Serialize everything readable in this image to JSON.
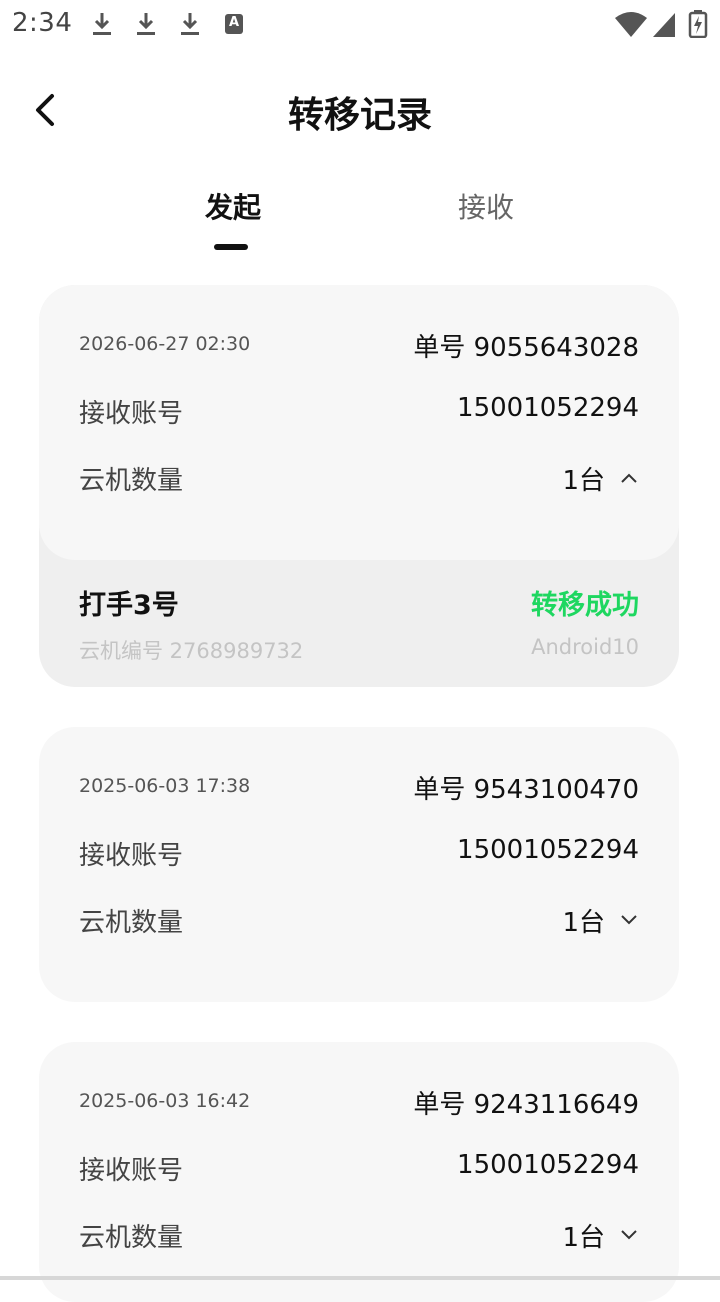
{
  "status_bar": {
    "time": "2:34",
    "icons": [
      "download-icon",
      "download-icon",
      "download-icon",
      "a-badge-icon",
      "wifi-icon",
      "signal-icon",
      "battery-charging-icon"
    ],
    "badge_letter": "A"
  },
  "header": {
    "title": "转移记录",
    "back_icon": "chevron-left-icon"
  },
  "tabs": [
    {
      "label": "发起",
      "active": true
    },
    {
      "label": "接收",
      "active": false
    }
  ],
  "records": [
    {
      "date": "2026-06-27 02:30",
      "order": "单号 9055643028",
      "receiver_label": "接收账号",
      "receiver": "15001052294",
      "count_label": "云机数量",
      "count": "1台",
      "expanded": true,
      "device": {
        "name": "打手3号",
        "status": "转移成功",
        "id": "云机编号 2768989732",
        "os": "Android10"
      }
    },
    {
      "date": "2025-06-03 17:38",
      "order": "单号 9543100470",
      "receiver_label": "接收账号",
      "receiver": "15001052294",
      "count_label": "云机数量",
      "count": "1台",
      "expanded": false
    },
    {
      "date": "2025-06-03 16:42",
      "order": "单号 9243116649",
      "receiver_label": "接收账号",
      "receiver": "15001052294",
      "count_label": "云机数量",
      "count": "1台",
      "expanded": false
    }
  ],
  "colors": {
    "success": "#1ed760",
    "card_bg": "#f7f7f7",
    "expanded_bg": "#efefef"
  }
}
